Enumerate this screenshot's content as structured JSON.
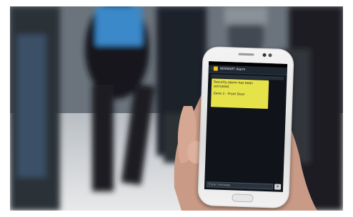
{
  "screen": {
    "title": "WiSMART Alarm",
    "message_line1": "Security alarm has been activated.",
    "message_line2": "Zone 1 - Front Door",
    "input_placeholder": "Enter message"
  },
  "colors": {
    "bubble": "#e6e24a",
    "screen_background": "#10141a",
    "phone_body": "#ececec"
  },
  "icons": {
    "app": "envelope-icon",
    "back": "back-arrow-icon",
    "send": "send-icon"
  }
}
